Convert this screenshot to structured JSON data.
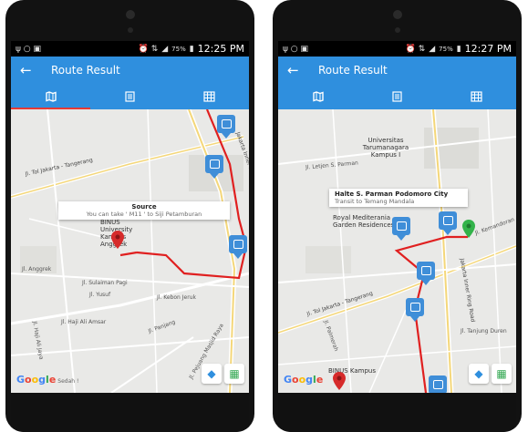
{
  "left": {
    "status": {
      "time": "12:25 PM",
      "battery": "75%",
      "left_icons": "ψ ○ ▣",
      "right_icons": "⏰ ⇅"
    },
    "appbar": {
      "back": "←",
      "title": "Route Result"
    },
    "map": {
      "labels": {
        "l1": "Jl. Tol Jakarta - Tangerang",
        "l2": "Jakarta Inner Ring Road",
        "l3": "BINUS University Kampus Anggrek",
        "l4": "Jl. Anggrek",
        "l5": "Jl. Sulaiman Pagi",
        "l6": "Jl. Yusuf",
        "l7": "Jl. Haji Ali Amsar",
        "l8": "Jl. Kebon Jeruk",
        "l9": "Jl. Haji Ali Jaya",
        "l10": "Jl. Panjang",
        "l11": "Jl. Pejuang Masjid Raya"
      },
      "popup": {
        "title": "Source",
        "subtitle": "You can take ' M11 ' to Siji Petamburan"
      },
      "google": {
        "word": "Google",
        "note": "Sedah !"
      }
    }
  },
  "right": {
    "status": {
      "time": "12:27 PM",
      "battery": "75%",
      "left_icons": "ψ ○ ▣",
      "right_icons": "⏰ ⇅"
    },
    "appbar": {
      "back": "←",
      "title": "Route Result"
    },
    "map": {
      "labels": {
        "l1": "Universitas Tarumanagara Kampus I",
        "l2": "Royal Mediterania Garden Residences",
        "l3": "Jakarta Inner Ring Road",
        "l4": "Jl. Tol Jakarta - Tangerang",
        "l5": "Jl. Kemandoran",
        "l6": "BINUS Kampus",
        "l7": "Jl. Letjen S. Parman",
        "l8": "Jl. Palmerah",
        "l9": "Jl. Tanjung Duren"
      },
      "popup": {
        "title": "Halte S. Parman Podomoro City",
        "subtitle": "Transit to Temang Mandala"
      },
      "google": {
        "word": "Google",
        "note": ""
      }
    }
  },
  "colors": {
    "accent": "#2f8fde",
    "route": "#e02020",
    "marker": "#3f8ed8",
    "destination": "#33b34a",
    "source": "#d62b2b"
  },
  "icons": {
    "tab1": "map-icon",
    "tab2": "list-icon",
    "tab3": "grid-icon"
  }
}
